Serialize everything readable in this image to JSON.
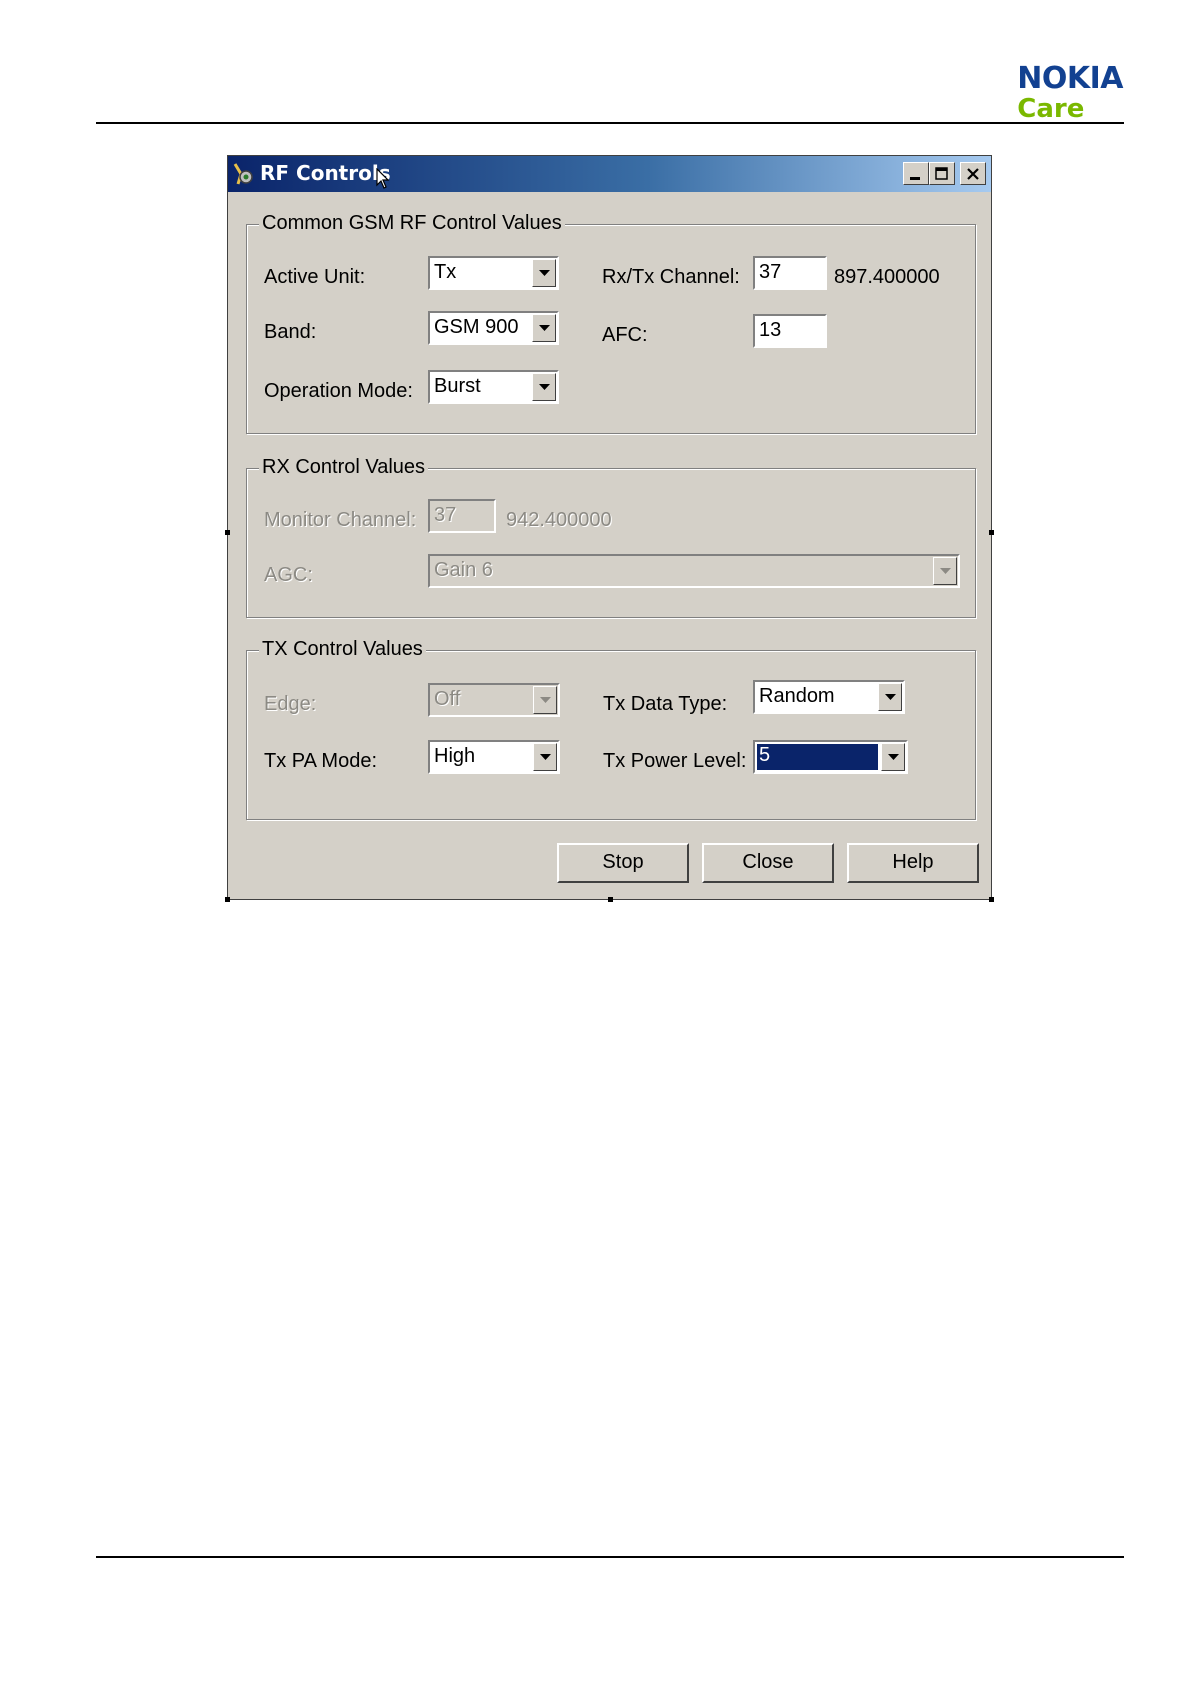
{
  "brand": {
    "name": "NOKIA",
    "sub": "Care"
  },
  "window": {
    "title": "RF Controls",
    "icon": "tools-icon",
    "controls": [
      "minimize-icon",
      "maximize-icon",
      "close-icon"
    ]
  },
  "common": {
    "legend": "Common GSM RF Control Values",
    "active_unit_label": "Active Unit:",
    "active_unit_value": "Tx",
    "band_label": "Band:",
    "band_value": "GSM 900",
    "operation_mode_label": "Operation Mode:",
    "operation_mode_value": "Burst",
    "channel_label": "Rx/Tx Channel:",
    "channel_value": "37",
    "channel_freq": "897.400000",
    "afc_label": "AFC:",
    "afc_value": "13"
  },
  "rx": {
    "legend": "RX Control Values",
    "monitor_label": "Monitor Channel:",
    "monitor_value": "37",
    "monitor_freq": "942.400000",
    "agc_label": "AGC:",
    "agc_value": "Gain 6"
  },
  "tx": {
    "legend": "TX Control Values",
    "edge_label": "Edge:",
    "edge_value": "Off",
    "pa_mode_label": "Tx PA Mode:",
    "pa_mode_value": "High",
    "data_type_label": "Tx Data Type:",
    "data_type_value": "Random",
    "power_label": "Tx Power Level:",
    "power_value": "5"
  },
  "buttons": {
    "stop": "Stop",
    "close": "Close",
    "help": "Help"
  },
  "colors": {
    "nokia_blue": "#124191",
    "care_green": "#7ab800",
    "title_start": "#0a246a",
    "title_end": "#a6caf0",
    "face": "#d4d0c8"
  }
}
